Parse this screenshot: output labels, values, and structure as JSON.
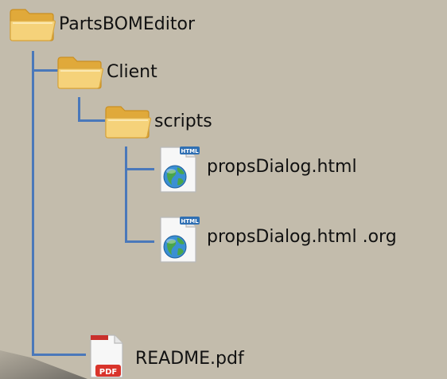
{
  "tree": {
    "root": {
      "label": "PartsBOMEditor",
      "icon": "folder-icon"
    },
    "client": {
      "label": "Client",
      "icon": "folder-icon"
    },
    "scripts": {
      "label": "scripts",
      "icon": "folder-icon"
    },
    "file1": {
      "label": "propsDialog.html",
      "icon": "html-file-icon",
      "badge": "HTML"
    },
    "file2": {
      "label": "propsDialog.html .org",
      "icon": "html-file-icon",
      "badge": "HTML"
    },
    "readme": {
      "label": "README.pdf",
      "icon": "pdf-file-icon",
      "badge": "PDF"
    }
  },
  "colors": {
    "background": "#c3bcac",
    "tree_line": "#4a78ba",
    "folder": "#f2c75c"
  }
}
